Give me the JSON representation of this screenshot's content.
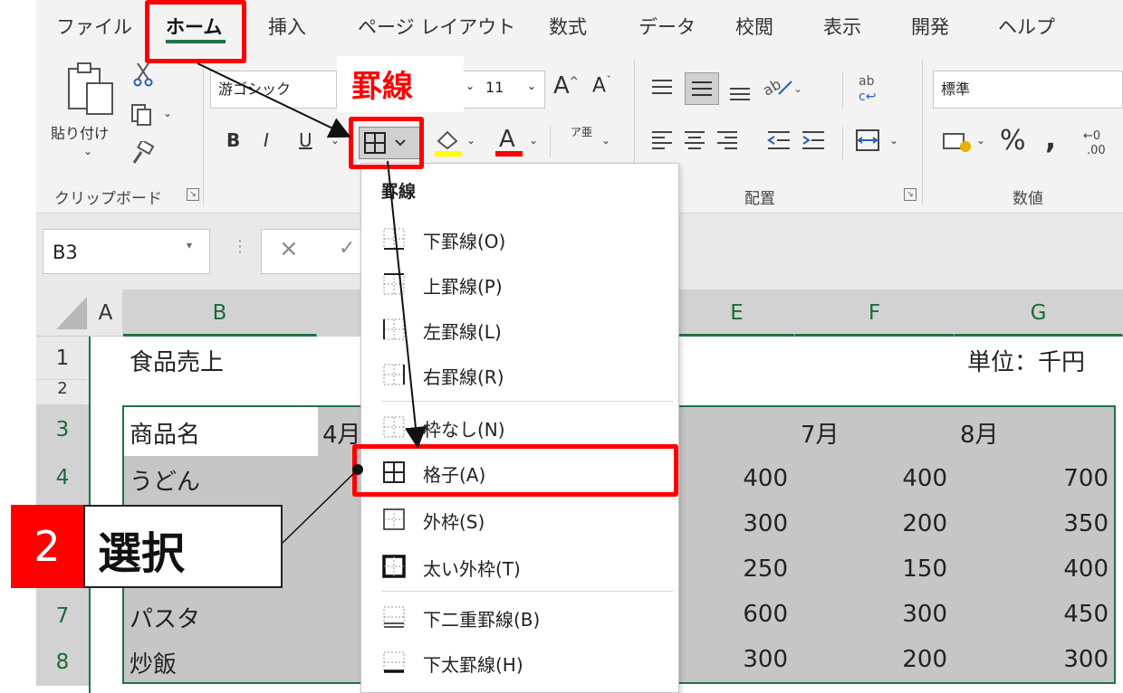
{
  "tabs": [
    "ファイル",
    "ホーム",
    "挿入",
    "ページ レイアウト",
    "数式",
    "データ",
    "校閲",
    "表示",
    "開発",
    "ヘルプ"
  ],
  "clipboard": {
    "paste_label": "貼り付け",
    "group_label": "クリップボード"
  },
  "font": {
    "name": "游ゴシック",
    "size": "11",
    "bold": "B",
    "italic": "I",
    "underline": "U",
    "phonetic": "ア亜"
  },
  "alignment": {
    "group_label": "配置"
  },
  "number": {
    "format": "標準",
    "group_label": "数値"
  },
  "name_box": "B3",
  "columns": [
    "A",
    "B",
    "E",
    "F",
    "G"
  ],
  "rows": [
    "1",
    "2",
    "3",
    "4",
    "7",
    "8"
  ],
  "sheet": {
    "title": "食品売上",
    "unit": "単位：千円",
    "header_product": "商品名",
    "months": [
      "4月",
      "7月",
      "8月"
    ],
    "products": [
      "うどん",
      "パスタ",
      "炒飯"
    ],
    "values": [
      [
        "400",
        "400",
        "700"
      ],
      [
        "300",
        "200",
        "350"
      ],
      [
        "250",
        "150",
        "400"
      ],
      [
        "600",
        "300",
        "450"
      ],
      [
        "300",
        "200",
        "300"
      ]
    ]
  },
  "menu": {
    "title": "罫線",
    "items": [
      "下罫線(O)",
      "上罫線(P)",
      "左罫線(L)",
      "右罫線(R)",
      "枠なし(N)",
      "格子(A)",
      "外枠(S)",
      "太い外枠(T)",
      "下二重罫線(B)",
      "下太罫線(H)"
    ]
  },
  "annotations": {
    "callout": "罫線",
    "step_number": "2",
    "step_text": "選択"
  },
  "colors": {
    "accent": "#217346",
    "highlight": "#ff0000",
    "selection": "#c6c6c6"
  }
}
